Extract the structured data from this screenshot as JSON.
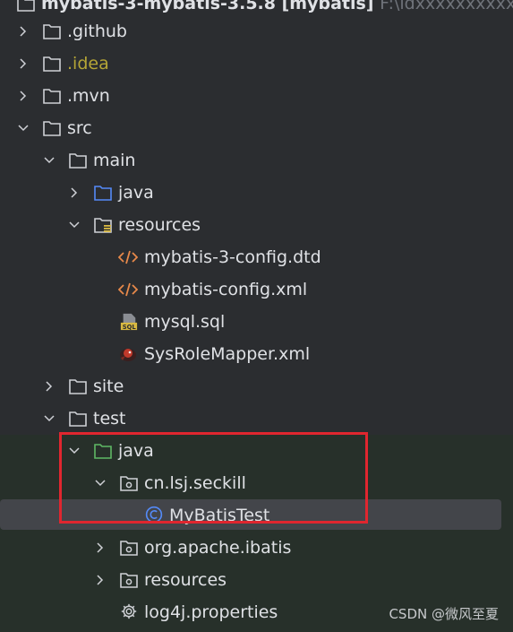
{
  "project_header": {
    "label": "mybatis-3-mybatis-3.5.8 [mybatis]",
    "path": "F:\\idxxxxxxxxxxxx"
  },
  "tree_items": [
    {
      "label": ".github",
      "icon": "folder-icon"
    },
    {
      "label": ".idea",
      "icon": "folder-icon"
    },
    {
      "label": ".mvn",
      "icon": "folder-icon"
    },
    {
      "label": "src",
      "icon": "folder-icon"
    },
    {
      "label": "main",
      "icon": "folder-icon"
    },
    {
      "label": "java",
      "icon": "source-folder-icon"
    },
    {
      "label": "resources",
      "icon": "resources-folder-icon"
    },
    {
      "label": "mybatis-3-config.dtd",
      "icon": "xml-code-icon"
    },
    {
      "label": "mybatis-config.xml",
      "icon": "xml-code-icon"
    },
    {
      "label": "mysql.sql",
      "icon": "sql-file-icon"
    },
    {
      "label": "SysRoleMapper.xml",
      "icon": "mybatis-bird-icon"
    },
    {
      "label": "site",
      "icon": "folder-icon"
    },
    {
      "label": "test",
      "icon": "folder-icon"
    },
    {
      "label": "java",
      "icon": "test-source-folder-icon"
    },
    {
      "label": "cn.lsj.seckill",
      "icon": "package-icon"
    },
    {
      "label": "MyBatisTest",
      "icon": "java-class-icon"
    },
    {
      "label": "org.apache.ibatis",
      "icon": "package-icon"
    },
    {
      "label": "resources",
      "icon": "package-icon"
    },
    {
      "label": "log4j.properties",
      "icon": "gear-icon"
    }
  ],
  "watermark": "CSDN @微风至夏",
  "colors": {
    "background": "#2b2d30",
    "text": "#dfe1e5",
    "test_area": "#27302a",
    "selection": "#43454a",
    "highlight_box": "#e0262f",
    "source_folder_blue": "#548af7",
    "test_folder_green": "#5fb865",
    "xml_orange": "#e8894a"
  }
}
